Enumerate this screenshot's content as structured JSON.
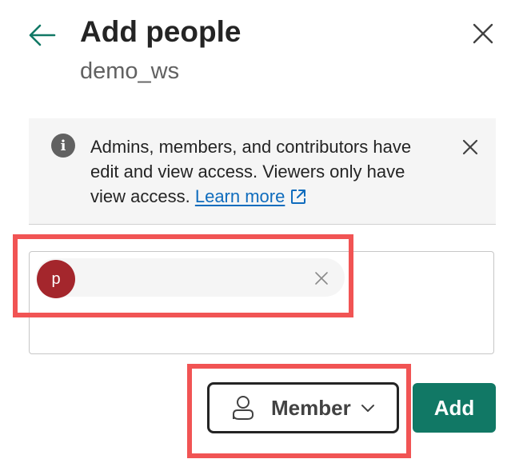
{
  "header": {
    "title": "Add people",
    "subtitle": "demo_ws"
  },
  "banner": {
    "message": "Admins, members, and contributors have edit and view access. Viewers only have view access.",
    "link_label": "Learn more"
  },
  "picker": {
    "selected_person_initial": "p",
    "avatar_color": "#a4262c"
  },
  "role": {
    "label": "Member"
  },
  "actions": {
    "add_label": "Add"
  },
  "colors": {
    "accent": "#117865",
    "link": "#0f6cbd",
    "highlight": "#f15454"
  },
  "icons": [
    "back-arrow-icon",
    "close-icon",
    "info-icon",
    "external-link-icon",
    "person-icon",
    "chevron-down-icon"
  ]
}
